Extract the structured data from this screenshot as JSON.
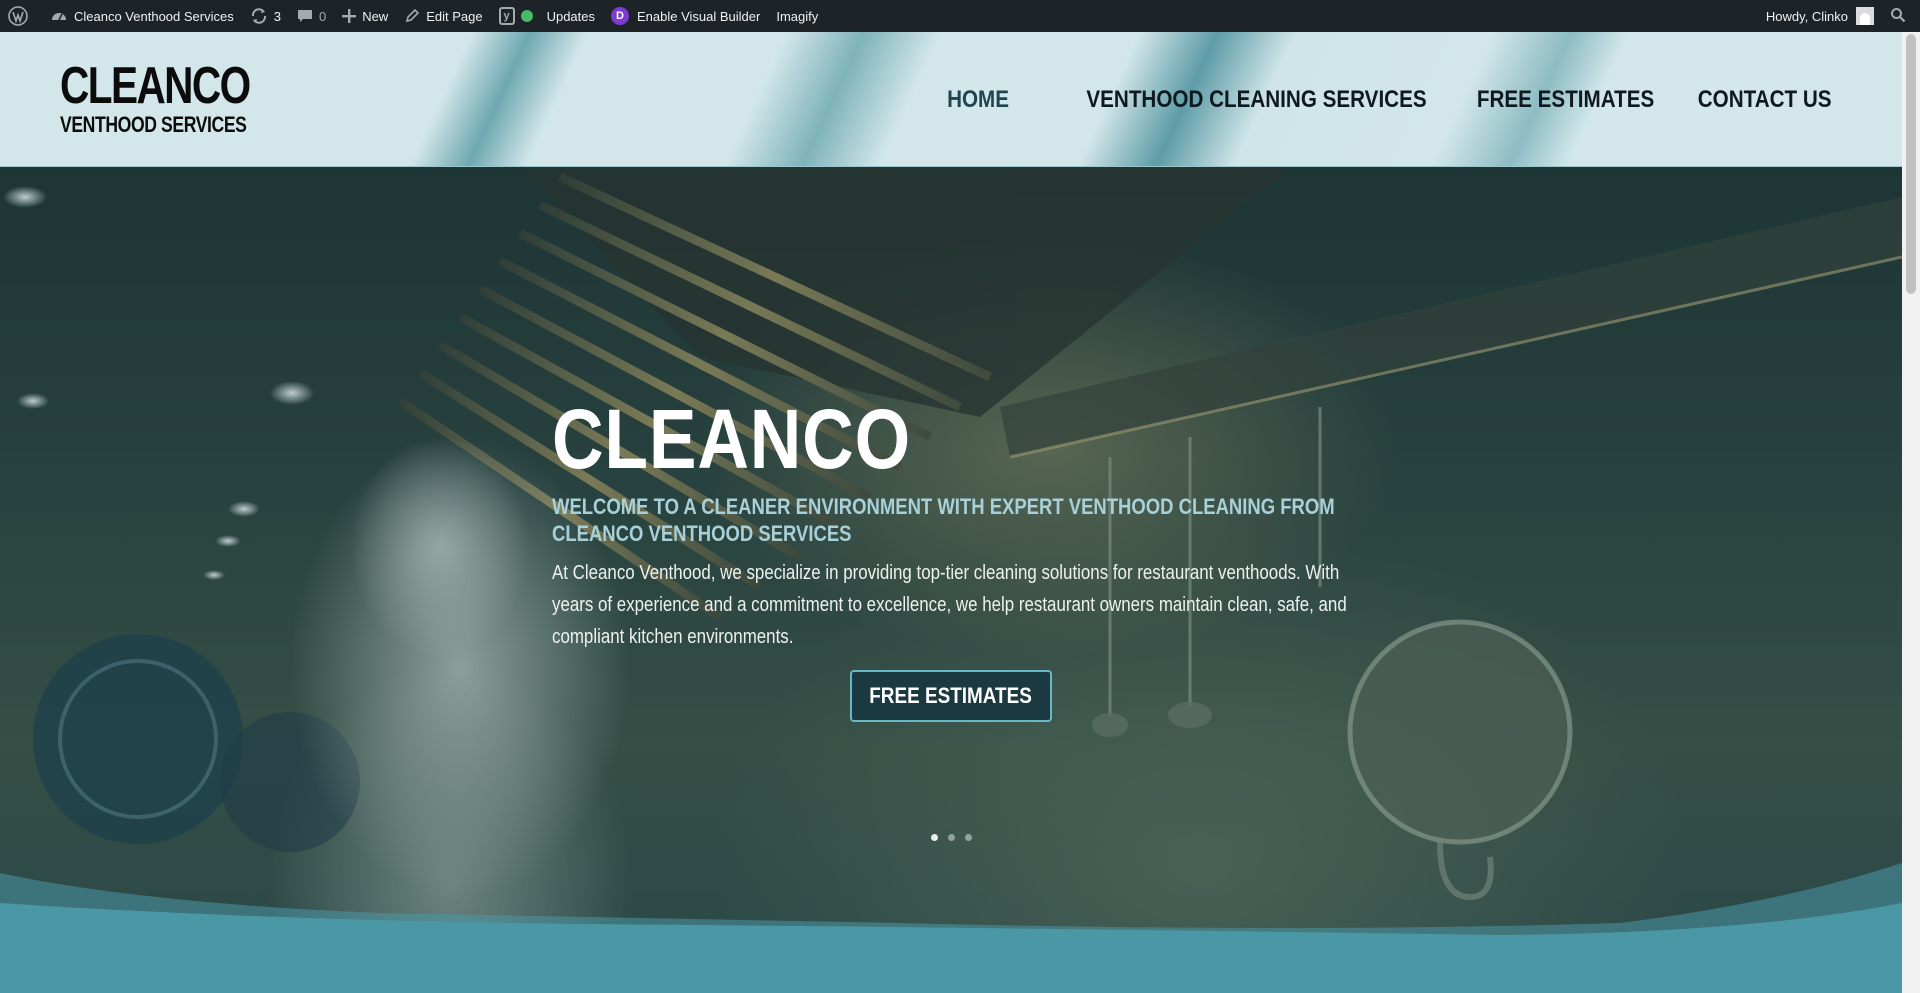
{
  "adminbar": {
    "site_name": "Cleanco Venthood Services",
    "updates_count": "3",
    "comments_count": "0",
    "new_label": "New",
    "edit_label": "Edit Page",
    "updates_label": "Updates",
    "visual_builder_label": "Enable Visual Builder",
    "divi_letter": "D",
    "yoast_letter": "y",
    "imagify_label": "Imagify",
    "howdy_label": "Howdy, Clinko"
  },
  "header": {
    "logo_main": "CLEANCO",
    "logo_sub": "VENTHOOD SERVICES",
    "nav": [
      {
        "label": "HOME",
        "active": true
      },
      {
        "label": "VENTHOOD CLEANING SERVICES"
      },
      {
        "label": "FREE ESTIMATES"
      },
      {
        "label": "CONTACT US"
      }
    ]
  },
  "hero": {
    "title": "CLEANCO",
    "subtitle": "WELCOME TO A CLEANER ENVIRONMENT WITH EXPERT VENTHOOD CLEANING FROM CLEANCO VENTHOOD SERVICES",
    "text": "At Cleanco Venthood, we specialize in providing top-tier cleaning solutions for restaurant venthoods. With years of experience and a commitment to excellence, we help restaurant owners maintain clean, safe, and compliant kitchen environments.",
    "button_label": "FREE ESTIMATES",
    "slides": 3,
    "active_slide": 1
  },
  "colors": {
    "adminbar_bg": "#1d2327",
    "header_bg": "#d3e7ea",
    "accent_teal": "#4a98a6",
    "subtitle_color": "#a7d0d8",
    "button_bg": "#1b3940",
    "button_border": "#67b8c6"
  },
  "icons": [
    "wordpress-icon",
    "dashboard-icon",
    "updates-icon",
    "comment-icon",
    "plus-icon",
    "pencil-icon",
    "yoast-icon",
    "divi-icon",
    "search-icon",
    "user-avatar"
  ]
}
